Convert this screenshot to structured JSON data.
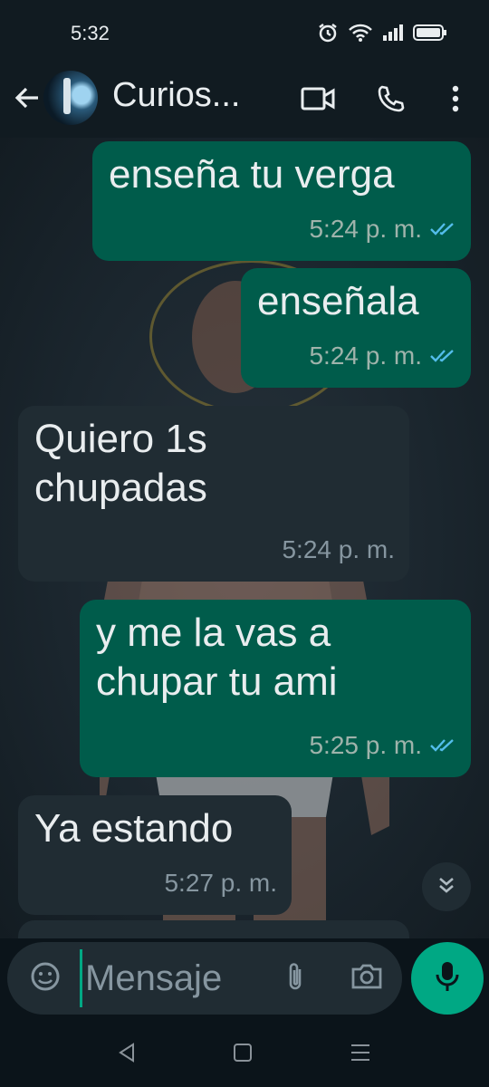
{
  "status_bar": {
    "time": "5:32",
    "icons": [
      "alarm-icon",
      "wifi-icon",
      "signal-icon",
      "battery-icon"
    ]
  },
  "app_bar": {
    "contact_name": "Curios...",
    "icons": [
      "back-arrow-icon",
      "video-call-icon",
      "voice-call-icon",
      "more-vert-icon"
    ]
  },
  "messages": [
    {
      "direction": "out",
      "text": "enseña tu verga",
      "time": "5:24 p. m.",
      "status": "read"
    },
    {
      "direction": "out",
      "text": "enseñala",
      "time": "5:24 p. m.",
      "status": "read"
    },
    {
      "direction": "in",
      "text_lines": [
        "Quiero 1s",
        "chupadas"
      ],
      "time": "5:24 p. m."
    },
    {
      "direction": "out",
      "text_lines": [
        "y me la vas a",
        "chupar tu ami"
      ],
      "time": "5:25 p. m.",
      "status": "read"
    },
    {
      "direction": "in",
      "text": "Ya estando",
      "time": "5:27 p. m."
    }
  ],
  "composer": {
    "placeholder": "Mensaje",
    "icons": [
      "sticker-icon",
      "attach-icon",
      "camera-icon",
      "mic-icon"
    ]
  },
  "nav_bar": {
    "icons": [
      "nav-back-icon",
      "nav-home-icon",
      "nav-recents-icon"
    ]
  },
  "colors": {
    "outgoing_bubble": "#005c4b",
    "incoming_bubble": "#202c33",
    "accent": "#00a884",
    "read_ticks": "#53bdeb"
  }
}
